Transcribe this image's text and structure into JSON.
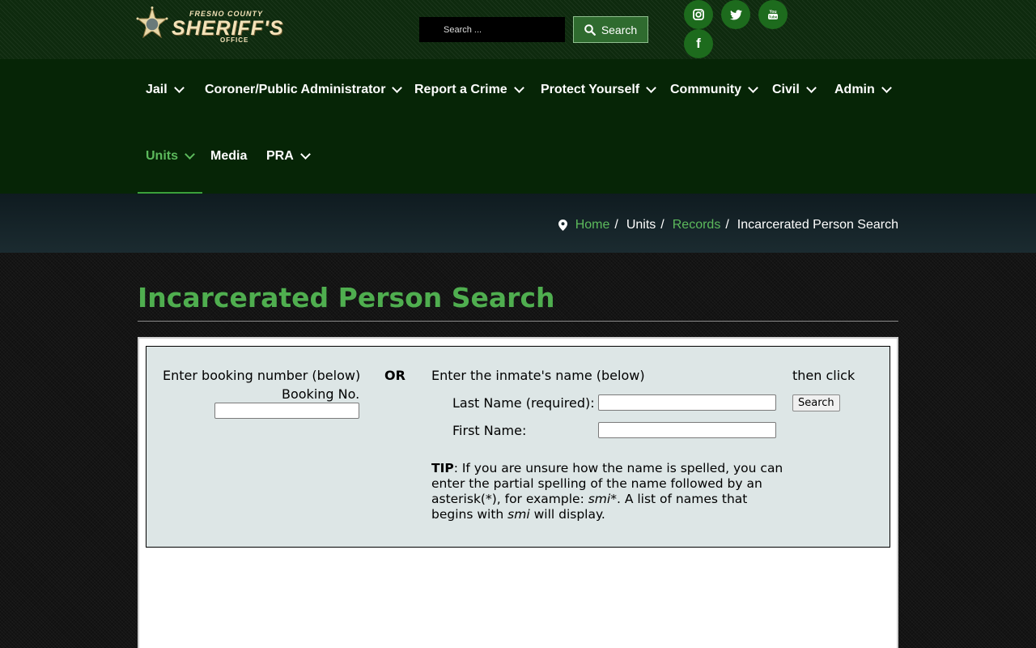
{
  "header": {
    "logo": {
      "line1": "FRESNO COUNTY",
      "line2": "SHERIFF'S",
      "line3": "OFFICE"
    },
    "search": {
      "placeholder": "Search ...",
      "button_label": "Search"
    },
    "social": [
      {
        "name": "instagram-icon",
        "glyph": "◙"
      },
      {
        "name": "twitter-icon",
        "glyph": "🐦"
      },
      {
        "name": "youtube-icon",
        "glyph": "▶"
      },
      {
        "name": "facebook-icon",
        "glyph": "f"
      }
    ]
  },
  "nav": {
    "items": [
      {
        "label": "Jail"
      },
      {
        "label": "Coroner/Public Administrator"
      },
      {
        "label": "Report a Crime"
      },
      {
        "label": "Protect Yourself"
      },
      {
        "label": "Community"
      },
      {
        "label": "Civil"
      },
      {
        "label": "Admin"
      },
      {
        "label": "Units"
      },
      {
        "label": "Media"
      },
      {
        "label": "PRA"
      }
    ]
  },
  "breadcrumb": {
    "home": "Home",
    "units": "Units",
    "records": "Records",
    "current": "Incarcerated Person Search",
    "sep": "/"
  },
  "page": {
    "title": "Incarcerated Person Search"
  },
  "form": {
    "booking_prompt": "Enter booking number (below)",
    "booking_label": "Booking No.",
    "or": "OR",
    "name_prompt": "Enter the inmate's name (below)",
    "last_name_label": "Last Name (required):",
    "first_name_label": "First Name:",
    "then_click": "then click",
    "search_button": "Search",
    "tip_label": "TIP",
    "tip_text_1": ": If you are unsure how the name is spelled, you can enter the partial spelling of the name followed by an asterisk(*), for example: ",
    "tip_example": "smi*",
    "tip_text_2": ". A list of names that begins with ",
    "tip_example_2": "smi",
    "tip_text_3": " will display."
  },
  "colors": {
    "accent": "#4fae4f",
    "nav_bg": "#062506",
    "topbar_bg": "#0e2a0e"
  }
}
